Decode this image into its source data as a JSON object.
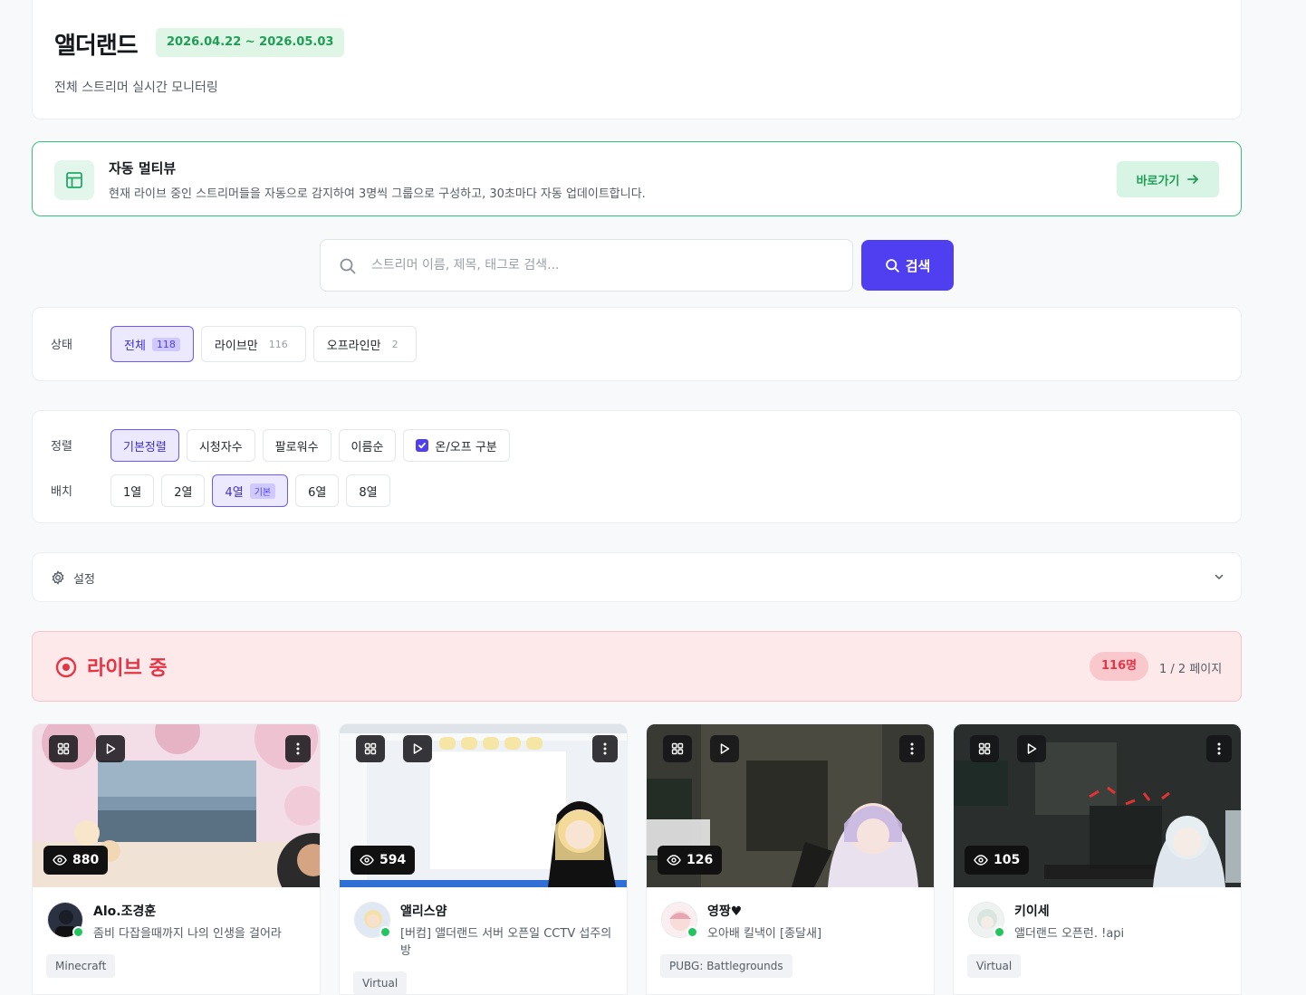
{
  "header": {
    "title": "앨더랜드",
    "date_range": "2026.04.22 ~ 2026.05.03",
    "subtitle": "전체 스트리머 실시간 모니터링"
  },
  "multiview": {
    "icon": "layout-icon",
    "title": "자동 멀티뷰",
    "description": "현재 라이브 중인 스트리머들을 자동으로 감지하여 3명씩 그룹으로 구성하고, 30초마다 자동 업데이트합니다.",
    "button_label": "바로가기"
  },
  "search": {
    "placeholder": "스트리머 이름, 제목, 태그로 검색...",
    "value": "",
    "button_label": "검색"
  },
  "filters": {
    "status_label": "상태",
    "status_options": [
      {
        "label": "전체",
        "count": "118",
        "active": true
      },
      {
        "label": "라이브만",
        "count": "116",
        "active": false
      },
      {
        "label": "오프라인만",
        "count": "2",
        "active": false
      }
    ],
    "sort_label": "정렬",
    "sort_options": [
      "기본정렬",
      "시청자수",
      "팔로워수",
      "이름순"
    ],
    "sort_active": "기본정렬",
    "onoff_label": "온/오프 구분",
    "onoff_checked": true,
    "layout_label": "배치",
    "layout_options": [
      "1열",
      "2열",
      "4열",
      "6열",
      "8열"
    ],
    "layout_active": "4열",
    "layout_default_badge": "기본"
  },
  "settings": {
    "label": "설정"
  },
  "live": {
    "title": "라이브 중",
    "count": "116명",
    "pagination": "1 / 2 페이지"
  },
  "streams": [
    {
      "name": "Alo.조경훈",
      "title": "좀비 다잡을때까지 나의 인생을 걸어라",
      "viewers": "880",
      "tag": "Minecraft",
      "online": true
    },
    {
      "name": "앨리스얌",
      "title": "[버컴] 앨더랜드 서버 오픈일 CCTV 섭주의 방",
      "viewers": "594",
      "tag": "Virtual",
      "online": true
    },
    {
      "name": "영짱♥",
      "title": "오아배 킬낵이 [종달새]",
      "viewers": "126",
      "tag": "PUBG: Battlegrounds",
      "online": true
    },
    {
      "name": "키이세",
      "title": "앨더랜드 오픈런. !api",
      "viewers": "105",
      "tag": "Virtual",
      "online": true
    }
  ],
  "colors": {
    "accent": "#4f3ff0",
    "green": "#1f9d55",
    "live_red": "#e53545",
    "online": "#22c55e"
  }
}
